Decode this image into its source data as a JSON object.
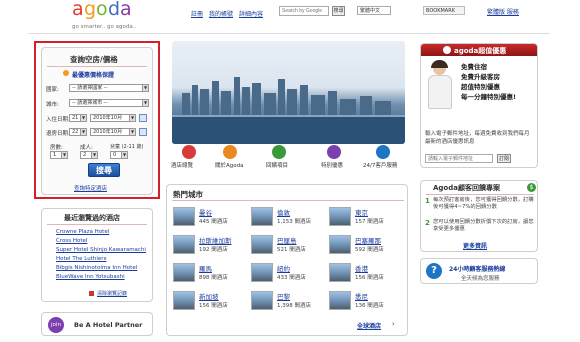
{
  "header": {
    "logo_letters": [
      "a",
      "g",
      "o",
      "d",
      "a"
    ],
    "logo_colors": [
      "#e23b2c",
      "#f39c1f",
      "#74b62e",
      "#3d6fc4",
      "#8b3aa8"
    ],
    "tagline": "go smarter.. go agoda..",
    "nav": [
      "註冊",
      "我的帳號",
      "詳細內容"
    ],
    "search_placeholder": "Search by Google",
    "search_button": "搜尋",
    "lang": "繁體中文",
    "bookmark": "BOOKMARK",
    "cs_link": "繁體版 服務"
  },
  "search_panel": {
    "title": "查詢空房/價格",
    "best_rate": "最優惠價格保證",
    "country_label": "國家:",
    "country_value": "-- 請選擇國家 --",
    "city_label": "城市:",
    "city_value": "-- 請選擇城市 --",
    "checkin_label": "入住日期:",
    "checkin_day": "21",
    "checkin_month": "2010年10月",
    "checkout_label": "退房日期:",
    "checkout_day": "22",
    "checkout_month": "2010年10月",
    "rooms_label": "房數:",
    "adults_label": "成人:",
    "children_label": "兒童 (2-11 歲)",
    "rooms_value": "1",
    "adults_value": "2",
    "children_value": "0",
    "search_button": "搜尋",
    "specific_link": "查詢特定酒店"
  },
  "recent": {
    "title": "最近瀏覽過的酒店",
    "items": [
      "Crowne Plaza Hotel",
      "Cross Hotel",
      "Super Hotel Shinjo Kawaramachi",
      "Hotel The Luthiers",
      "Bibgis Nishinotoima Inn Hotel",
      "BlueWave Inn Yotsubashi"
    ],
    "clear": "清除瀏覽記錄"
  },
  "partner": {
    "badge": "join",
    "label": "Be A Hotel Partner"
  },
  "features": [
    "酒店總覽",
    "關於Agoda",
    "回饋項目",
    "特別優惠",
    "24/7客戶服務"
  ],
  "feature_colors": [
    "#d93b3b",
    "#e88a1f",
    "#3a9a3a",
    "#7b3fb0",
    "#1f74c4"
  ],
  "popular": {
    "title": "熱門城市",
    "cities": [
      {
        "name": "曼谷",
        "count": "445 間酒店"
      },
      {
        "name": "倫敦",
        "count": "1,153 間酒店"
      },
      {
        "name": "東京",
        "count": "157 間酒店"
      },
      {
        "name": "拉斯維加斯",
        "count": "192 間酒店"
      },
      {
        "name": "巴厘島",
        "count": "521 間酒店"
      },
      {
        "name": "巴塞羅那",
        "count": "592 間酒店"
      },
      {
        "name": "羅馬",
        "count": "898 間酒店"
      },
      {
        "name": "紐約",
        "count": "433 間酒店"
      },
      {
        "name": "香港",
        "count": "156 間酒店"
      },
      {
        "name": "新加坡",
        "count": "156 間酒店"
      },
      {
        "name": "巴黎",
        "count": "1,398 間酒店"
      },
      {
        "name": "悉尼",
        "count": "136 間酒店"
      }
    ],
    "all_link": "全球酒店"
  },
  "promo": {
    "title": "agoda超值優惠",
    "lines": [
      "免費住宿",
      "免費升級客房",
      "超值特別優惠",
      "每一分鐘特別優惠!"
    ],
    "text": "輸入電子郵件地址，每週免費收到我們每月最新的酒店優惠訊息",
    "email_placeholder": "請輸入電子郵件地址",
    "subscribe": "訂閱"
  },
  "reviews": {
    "title": "Agoda顧客回饋專案",
    "item1": "每次預訂客房後，您可獲得回饋分數，訂購後可獲得4~7%的回饋分數",
    "item2": "您可以使用回饋分數折價下次的訂房，讓您享受更多優惠",
    "more": "更多資訊"
  },
  "support": {
    "title": "24小時顧客服務熱線",
    "subtitle": "全天候為您服務"
  }
}
